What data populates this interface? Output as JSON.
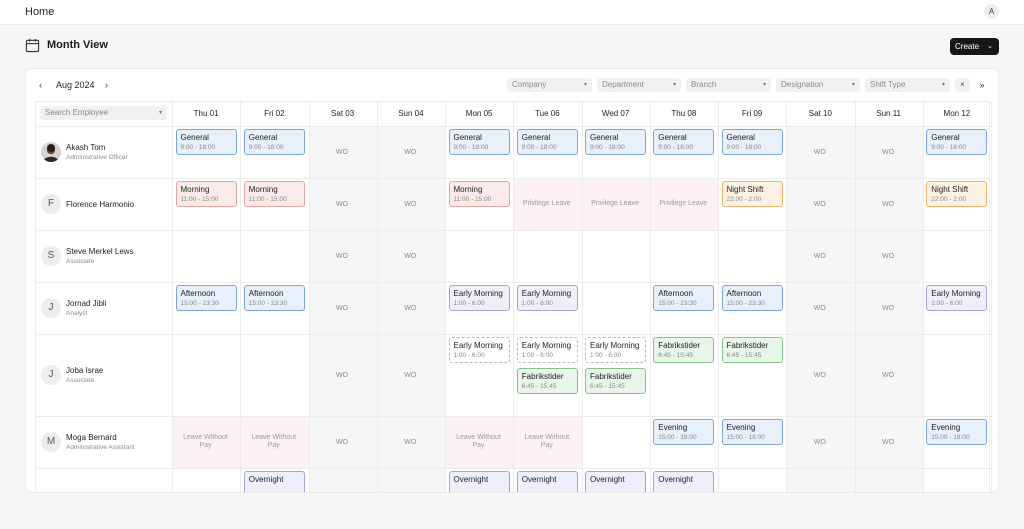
{
  "topbar": {
    "home_label": "Home",
    "avatar_initial": "A"
  },
  "header": {
    "title": "Month View",
    "create_label": "Create"
  },
  "toolbar": {
    "month_label": "Aug 2024",
    "filters": [
      "Company",
      "Department",
      "Branch",
      "Designation",
      "Shift Type"
    ],
    "clear_icon": "×",
    "expand_icon": "»"
  },
  "grid": {
    "search_placeholder": "Search Employee",
    "days": [
      "Thu 01",
      "Fri 02",
      "Sat 03",
      "Sun 04",
      "Mon 05",
      "Tue 06",
      "Wed 07",
      "Thu 08",
      "Fri 09",
      "Sat 10",
      "Sun 11",
      "Mon 12"
    ],
    "weekend_columns": [
      2,
      3,
      9,
      10
    ],
    "employees": [
      {
        "name": "Akash Tom",
        "role": "Administrative Officer",
        "initial": "",
        "photo": true
      },
      {
        "name": "Florence Harmonio",
        "role": "",
        "initial": "F"
      },
      {
        "name": "Steve Merkel Lews",
        "role": "Associate",
        "initial": "S"
      },
      {
        "name": "Jornad Jibli",
        "role": "Analyst",
        "initial": "J"
      },
      {
        "name": "Joba Israe",
        "role": "Associate",
        "initial": "J"
      },
      {
        "name": "Moga Bernard",
        "role": "Administrative Assistant",
        "initial": "M"
      },
      {
        "name": "",
        "role": "",
        "initial": ""
      }
    ],
    "weekly_off_label": "WO",
    "shifts": [
      {
        "row": 0,
        "col": 0,
        "name": "General",
        "time": "9:00 - 18:00",
        "color": "blue"
      },
      {
        "row": 0,
        "col": 1,
        "name": "General",
        "time": "9:00 - 18:00",
        "color": "blue"
      },
      {
        "row": 0,
        "col": 4,
        "name": "General",
        "time": "9:00 - 18:00",
        "color": "blue"
      },
      {
        "row": 0,
        "col": 5,
        "name": "General",
        "time": "9:00 - 18:00",
        "color": "blue"
      },
      {
        "row": 0,
        "col": 6,
        "name": "General",
        "time": "9:00 - 18:00",
        "color": "blue"
      },
      {
        "row": 0,
        "col": 7,
        "name": "General",
        "time": "9:00 - 18:00",
        "color": "blue"
      },
      {
        "row": 0,
        "col": 8,
        "name": "General",
        "time": "9:00 - 18:00",
        "color": "blue"
      },
      {
        "row": 0,
        "col": 11,
        "name": "General",
        "time": "9:00 - 18:00",
        "color": "blue"
      },
      {
        "row": 1,
        "col": 0,
        "name": "Morning",
        "time": "11:00 - 15:00",
        "color": "red"
      },
      {
        "row": 1,
        "col": 1,
        "name": "Morning",
        "time": "11:00 - 15:00",
        "color": "red"
      },
      {
        "row": 1,
        "col": 4,
        "name": "Morning",
        "time": "11:00 - 15:00",
        "color": "red"
      },
      {
        "row": 1,
        "col": 8,
        "name": "Night Shift",
        "time": "22:00 - 2:00",
        "color": "orange"
      },
      {
        "row": 1,
        "col": 11,
        "name": "Night Shift",
        "time": "22:00 - 2:00",
        "color": "orange"
      },
      {
        "row": 3,
        "col": 0,
        "name": "Afternoon",
        "time": "15:00 - 23:30",
        "color": "blue"
      },
      {
        "row": 3,
        "col": 1,
        "name": "Afternoon",
        "time": "15:00 - 23:30",
        "color": "blue"
      },
      {
        "row": 3,
        "col": 4,
        "name": "Early Morning",
        "time": "1:00 - 6:00",
        "color": "purple"
      },
      {
        "row": 3,
        "col": 5,
        "name": "Early Morning",
        "time": "1:00 - 6:00",
        "color": "purple"
      },
      {
        "row": 3,
        "col": 7,
        "name": "Afternoon",
        "time": "15:00 - 23:30",
        "color": "blue"
      },
      {
        "row": 3,
        "col": 8,
        "name": "Afternoon",
        "time": "15:00 - 23:30",
        "color": "blue"
      },
      {
        "row": 3,
        "col": 11,
        "name": "Early Morning",
        "time": "1:00 - 6:00",
        "color": "purple"
      },
      {
        "row": 4,
        "col": 4,
        "name": "Early Morning",
        "time": "1:00 - 6:00",
        "color": "dashed"
      },
      {
        "row": 4,
        "col": 5,
        "name": "Early Morning",
        "time": "1:00 - 6:00",
        "color": "dashed"
      },
      {
        "row": 4,
        "col": 6,
        "name": "Early Morning",
        "time": "1:00 - 6:00",
        "color": "dashed"
      },
      {
        "row": 4,
        "col": 5,
        "slot": 1,
        "name": "Fabrikstider",
        "time": "6:45 - 15:45",
        "color": "green"
      },
      {
        "row": 4,
        "col": 6,
        "slot": 1,
        "name": "Fabrikstider",
        "time": "6:45 - 15:45",
        "color": "green"
      },
      {
        "row": 4,
        "col": 7,
        "name": "Fabrikstider",
        "time": "6:45 - 15:45",
        "color": "green"
      },
      {
        "row": 4,
        "col": 8,
        "name": "Fabrikstider",
        "time": "6:45 - 15:45",
        "color": "green"
      },
      {
        "row": 5,
        "col": 7,
        "name": "Evening",
        "time": "15:00 - 18:00",
        "color": "blue"
      },
      {
        "row": 5,
        "col": 8,
        "name": "Evening",
        "time": "15:00 - 18:00",
        "color": "blue"
      },
      {
        "row": 5,
        "col": 11,
        "name": "Evening",
        "time": "15:00 - 18:00",
        "color": "blue"
      },
      {
        "row": 6,
        "col": 1,
        "name": "Overnight",
        "time": "",
        "color": "purple"
      },
      {
        "row": 6,
        "col": 4,
        "name": "Overnight",
        "time": "",
        "color": "purple"
      },
      {
        "row": 6,
        "col": 5,
        "name": "Overnight",
        "time": "",
        "color": "purple"
      },
      {
        "row": 6,
        "col": 6,
        "name": "Overnight",
        "time": "",
        "color": "purple"
      },
      {
        "row": 6,
        "col": 7,
        "name": "Overnight",
        "time": "",
        "color": "purple"
      }
    ],
    "weekly_offs": [
      [
        0,
        2
      ],
      [
        0,
        3
      ],
      [
        0,
        9
      ],
      [
        0,
        10
      ],
      [
        1,
        2
      ],
      [
        1,
        3
      ],
      [
        1,
        9
      ],
      [
        1,
        10
      ],
      [
        2,
        2
      ],
      [
        2,
        3
      ],
      [
        2,
        9
      ],
      [
        2,
        10
      ],
      [
        3,
        2
      ],
      [
        3,
        3
      ],
      [
        3,
        9
      ],
      [
        3,
        10
      ],
      [
        4,
        2
      ],
      [
        4,
        3
      ],
      [
        4,
        9
      ],
      [
        4,
        10
      ],
      [
        5,
        2
      ],
      [
        5,
        3
      ],
      [
        5,
        9
      ],
      [
        5,
        10
      ]
    ],
    "leaves": [
      {
        "row": 1,
        "col": 5,
        "label": "Privilege Leave"
      },
      {
        "row": 1,
        "col": 6,
        "label": "Privilege Leave"
      },
      {
        "row": 1,
        "col": 7,
        "label": "Privilege Leave"
      },
      {
        "row": 5,
        "col": 0,
        "label": "Leave Without Pay"
      },
      {
        "row": 5,
        "col": 1,
        "label": "Leave Without Pay"
      },
      {
        "row": 5,
        "col": 4,
        "label": "Leave Without Pay"
      },
      {
        "row": 5,
        "col": 5,
        "label": "Leave Without Pay"
      }
    ]
  }
}
